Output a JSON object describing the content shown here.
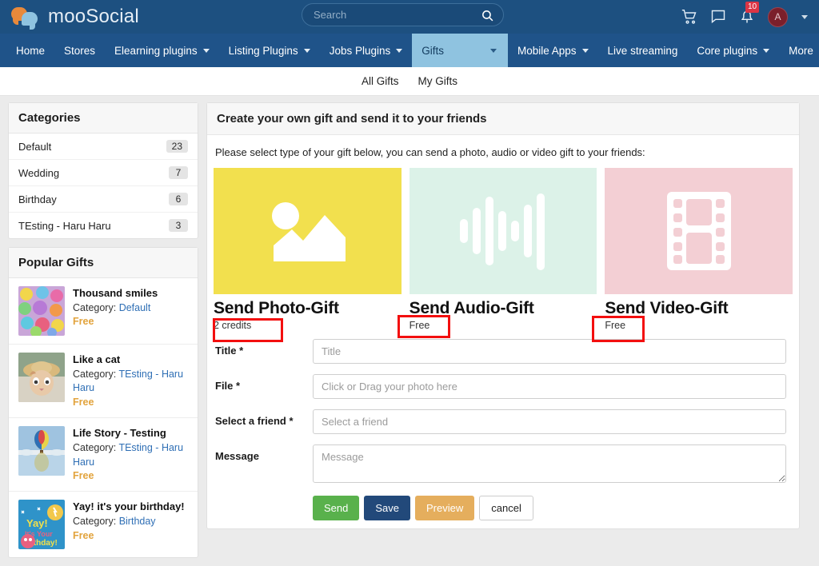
{
  "header": {
    "brand": "mooSocial",
    "logo_icon": "chat-bubbles-logo",
    "search": {
      "placeholder": "Search",
      "value": "",
      "icon": "search-icon"
    },
    "actions": [
      {
        "name": "cart-icon",
        "label": "Cart"
      },
      {
        "name": "messages-icon",
        "label": "Messages"
      },
      {
        "name": "notifications-icon",
        "label": "Notifications",
        "badge": "10"
      }
    ],
    "account": {
      "initial": "A",
      "caret": "chevron-down-icon"
    }
  },
  "nav": {
    "items": [
      {
        "label": "Home",
        "caret": false,
        "active": false
      },
      {
        "label": "Stores",
        "caret": false,
        "active": false
      },
      {
        "label": "Elearning plugins",
        "caret": true,
        "active": false
      },
      {
        "label": "Listing Plugins",
        "caret": true,
        "active": false
      },
      {
        "label": "Jobs Plugins",
        "caret": true,
        "active": false
      },
      {
        "label": "Gifts",
        "caret": true,
        "active": true
      },
      {
        "label": "Mobile Apps",
        "caret": true,
        "active": false
      },
      {
        "label": "Live streaming",
        "caret": false,
        "active": false
      },
      {
        "label": "Core plugins",
        "caret": true,
        "active": false
      },
      {
        "label": "More",
        "caret": true,
        "active": false
      }
    ]
  },
  "subnav": {
    "items": [
      "All Gifts",
      "My Gifts"
    ]
  },
  "sidebar": {
    "categories": {
      "title": "Categories",
      "items": [
        {
          "label": "Default",
          "count": "23"
        },
        {
          "label": "Wedding",
          "count": "7"
        },
        {
          "label": "Birthday",
          "count": "6"
        },
        {
          "label": "TEsting - Haru Haru",
          "count": "3"
        }
      ]
    },
    "popular": {
      "title": "Popular Gifts",
      "category_prefix": "Category:",
      "items": [
        {
          "title": "Thousand smiles",
          "category": "Default",
          "price": "Free",
          "thumb": "buttons-photo"
        },
        {
          "title": "Like a cat",
          "category": "TEsting - Haru Haru",
          "price": "Free",
          "thumb": "cat-photo"
        },
        {
          "title": "Life Story - Testing",
          "category": "TEsting - Haru Haru",
          "price": "Free",
          "thumb": "balloon-photo"
        },
        {
          "title": "Yay! it's your birthday!",
          "category": "Birthday",
          "price": "Free",
          "thumb": "birthday-photo"
        }
      ]
    }
  },
  "main": {
    "title": "Create your own gift and send it to your friends",
    "intro": "Please select type of your gift below, you can send a photo, audio or video gift to your friends:",
    "types": [
      {
        "title": "Send Photo-Gift",
        "price": "2 credits",
        "icon": "image-icon",
        "bg": "#f2e04e",
        "annotated": true
      },
      {
        "title": "Send Audio-Gift",
        "price": "Free",
        "icon": "audio-waveform-icon",
        "bg": "#dcf2e8",
        "annotated": true
      },
      {
        "title": "Send Video-Gift",
        "price": "Free",
        "icon": "film-strip-icon",
        "bg": "#f3cfd4",
        "annotated": true
      }
    ],
    "form": {
      "fields": [
        {
          "label": "Title *",
          "placeholder": "Title",
          "value": "",
          "type": "text",
          "name": "title-field"
        },
        {
          "label": "File *",
          "placeholder": "Click or Drag your photo here",
          "value": "",
          "type": "text",
          "name": "file-field"
        },
        {
          "label": "Select a friend *",
          "placeholder": "Select a friend",
          "value": "",
          "type": "text",
          "name": "friend-field"
        },
        {
          "label": "Message",
          "placeholder": "Message",
          "value": "",
          "type": "textarea",
          "name": "message-field"
        }
      ],
      "buttons": [
        {
          "label": "Send",
          "name": "send-button"
        },
        {
          "label": "Save",
          "name": "save-button"
        },
        {
          "label": "Preview",
          "name": "preview-button"
        },
        {
          "label": "cancel",
          "name": "cancel-button"
        }
      ]
    }
  },
  "colors": {
    "topbar": "#1d5080",
    "nav": "#1f5389",
    "nav_active": "#8fc3e0",
    "link": "#2f6fb5",
    "free": "#e2a33c",
    "annotation": "#f30f0f",
    "send": "#59b14c",
    "save": "#22497a",
    "preview": "#e5ae5d"
  }
}
